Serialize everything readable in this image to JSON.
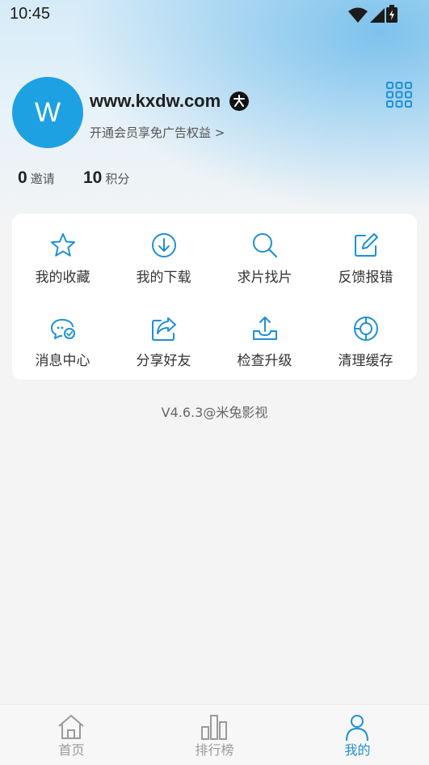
{
  "status_bar": {
    "time": "10:45"
  },
  "profile": {
    "avatar_letter": "W",
    "username": "www.kxdw.com",
    "vip_link": "开通会员享免广告权益 >"
  },
  "stats": [
    {
      "value": "0",
      "label": "邀请"
    },
    {
      "value": "10",
      "label": "积分"
    }
  ],
  "menu": [
    {
      "label": "我的收藏",
      "icon": "star-icon"
    },
    {
      "label": "我的下载",
      "icon": "download-icon"
    },
    {
      "label": "求片找片",
      "icon": "search-icon"
    },
    {
      "label": "反馈报错",
      "icon": "edit-icon"
    },
    {
      "label": "消息中心",
      "icon": "message-icon"
    },
    {
      "label": "分享好友",
      "icon": "share-icon"
    },
    {
      "label": "检查升级",
      "icon": "upload-icon"
    },
    {
      "label": "清理缓存",
      "icon": "clean-cache-icon"
    }
  ],
  "version": "V4.6.3@米兔影视",
  "tabs": [
    {
      "label": "首页",
      "icon": "home-icon"
    },
    {
      "label": "排行榜",
      "icon": "ranking-icon"
    },
    {
      "label": "我的",
      "icon": "user-icon",
      "active": true
    }
  ],
  "colors": {
    "accent": "#1e90d6",
    "avatar": "#1ea1e3"
  }
}
